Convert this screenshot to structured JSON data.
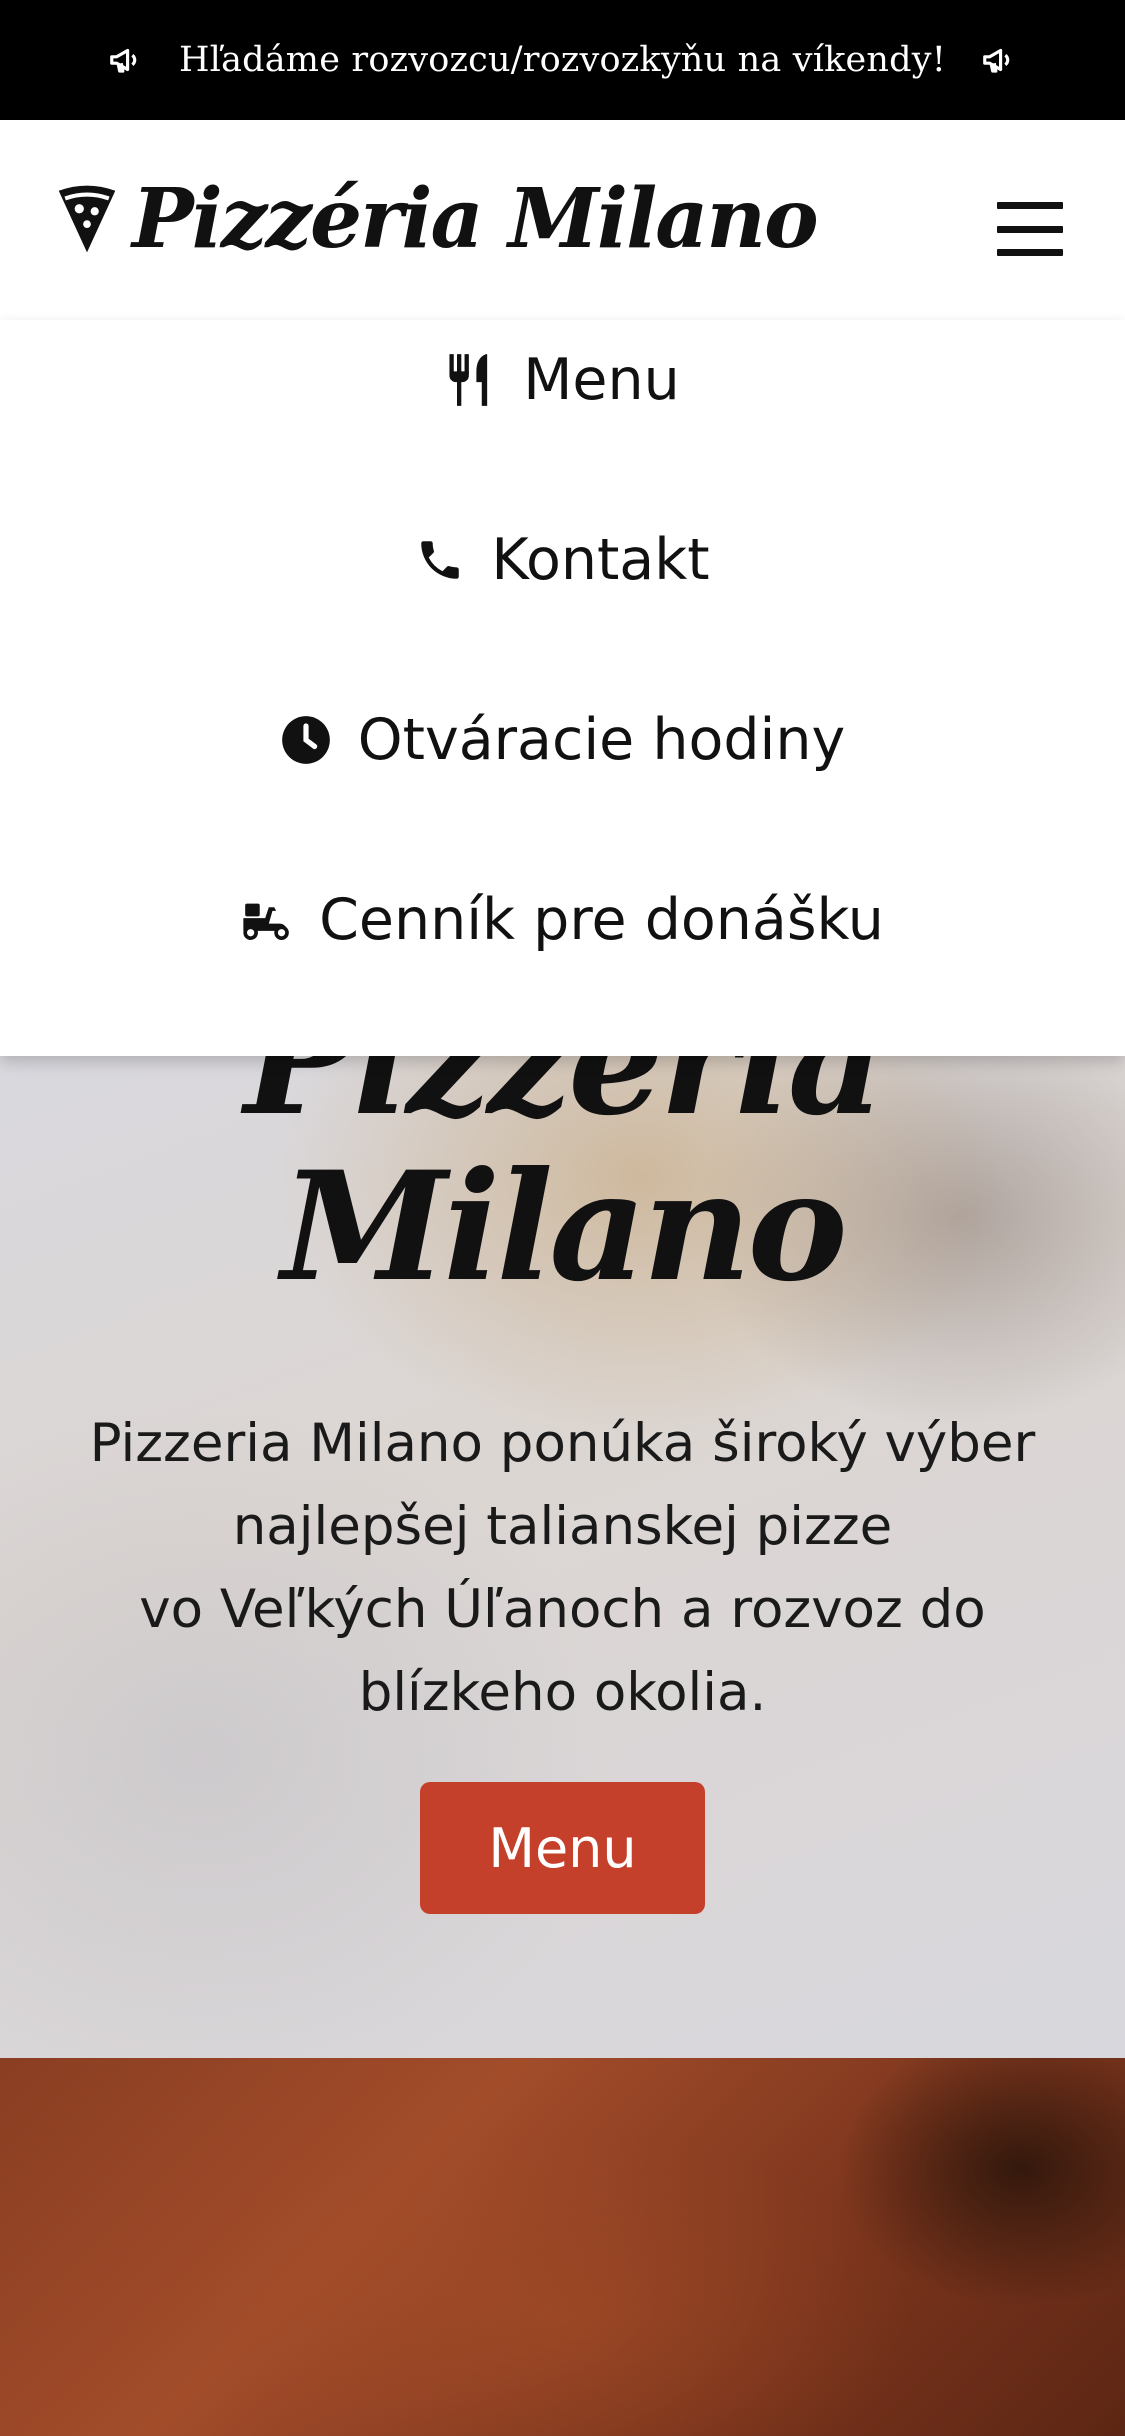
{
  "announcement": {
    "text": "Hľadáme rozvozcu/rozvozkyňu na víkendy!",
    "icon": "megaphone-icon"
  },
  "header": {
    "logo_text": "Pizzéria Milano",
    "logo_icon": "pizza-slice-icon",
    "menu_toggle_icon": "hamburger-icon"
  },
  "nav": {
    "items": [
      {
        "label": "Menu",
        "icon": "utensils-icon"
      },
      {
        "label": "Kontakt",
        "icon": "phone-icon"
      },
      {
        "label": "Otváracie hodiny",
        "icon": "clock-icon"
      },
      {
        "label": "Cenník pre donášku",
        "icon": "scooter-icon"
      }
    ]
  },
  "hero": {
    "title_line1": "Pizzéria",
    "title_line2": "Milano",
    "description_lines": [
      "Pizzeria Milano ponúka široký výber",
      "najlepšej talianskej pizze",
      "vo Veľkých Úľanoch a rozvoz do",
      "blízkeho okolia."
    ],
    "button_label": "Menu",
    "button_color": "#c4402b"
  }
}
